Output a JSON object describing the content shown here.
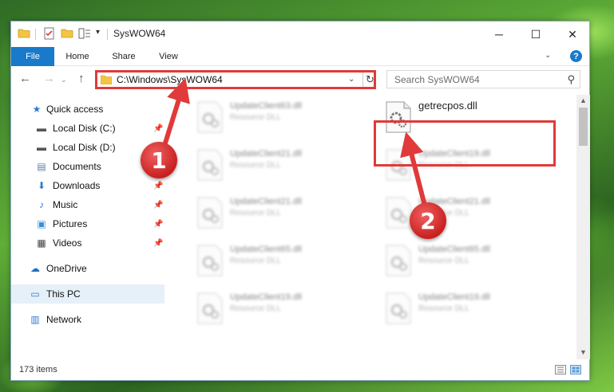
{
  "window": {
    "title": "SysWOW64",
    "min_glyph": "─",
    "max_glyph": "☐",
    "close_glyph": "✕"
  },
  "ribbon": {
    "tabs": [
      "File",
      "Home",
      "Share",
      "View"
    ],
    "chevron_glyph": "⌄",
    "help_glyph": "?",
    "file_tab_color": "#1979ca"
  },
  "nav": {
    "back_glyph": "←",
    "forward_glyph": "→",
    "recent_glyph": "⌄",
    "up_glyph": "↑",
    "address": "C:\\Windows\\SysWOW64",
    "address_dropdown_glyph": "⌄",
    "refresh_glyph": "↻",
    "search_placeholder": "Search SysWOW64",
    "search_glyph": "⚲"
  },
  "sidebar": {
    "items": [
      {
        "label": "Quick access",
        "icon": "star-icon",
        "glyph": "★",
        "pinned": false
      },
      {
        "label": "Local Disk (C:)",
        "icon": "drive-icon",
        "glyph": "▬",
        "pinned": true
      },
      {
        "label": "Local Disk (D:)",
        "icon": "drive-icon",
        "glyph": "▬",
        "pinned": false
      },
      {
        "label": "Documents",
        "icon": "documents-icon",
        "glyph": "▤",
        "pinned": true
      },
      {
        "label": "Downloads",
        "icon": "downloads-icon",
        "glyph": "⬇",
        "pinned": true
      },
      {
        "label": "Music",
        "icon": "music-icon",
        "glyph": "♪",
        "pinned": true
      },
      {
        "label": "Pictures",
        "icon": "pictures-icon",
        "glyph": "▣",
        "pinned": true
      },
      {
        "label": "Videos",
        "icon": "videos-icon",
        "glyph": "▦",
        "pinned": true
      },
      {
        "label": "OneDrive",
        "icon": "onedrive-icon",
        "glyph": "☁",
        "pinned": false
      },
      {
        "label": "This PC",
        "icon": "computer-icon",
        "glyph": "▭",
        "pinned": false,
        "selected": true
      },
      {
        "label": "Network",
        "icon": "network-icon",
        "glyph": "▥",
        "pinned": false
      }
    ],
    "pin_glyph": "📌",
    "selected_color": "#e5f0f9"
  },
  "files": [
    {
      "name": "UpdateClient63.dll",
      "type": "Resource DLL",
      "blurred": true
    },
    {
      "name": "getrecpos.dll",
      "type": "",
      "blurred": false,
      "highlighted": true
    },
    {
      "name": "UpdateClient21.dll",
      "type": "Resource DLL",
      "blurred": true
    },
    {
      "name": "UpdateClient19.dll",
      "type": "Resource DLL",
      "blurred": true
    },
    {
      "name": "UpdateClient21.dll",
      "type": "Resource DLL",
      "blurred": true
    },
    {
      "name": "UpdateClient21.dll",
      "type": "Resource DLL",
      "blurred": true
    },
    {
      "name": "UpdateClient65.dll",
      "type": "Resource DLL",
      "blurred": true
    },
    {
      "name": "UpdateClient65.dll",
      "type": "Resource DLL",
      "blurred": true
    },
    {
      "name": "UpdateClient19.dll",
      "type": "Resource DLL",
      "blurred": true
    },
    {
      "name": "UpdateClient19.dll",
      "type": "Resource DLL",
      "blurred": true
    }
  ],
  "status": {
    "item_count": "173 items"
  },
  "annotations": {
    "callout_1": "1",
    "callout_2": "2",
    "highlight_color": "#e03a3a"
  }
}
